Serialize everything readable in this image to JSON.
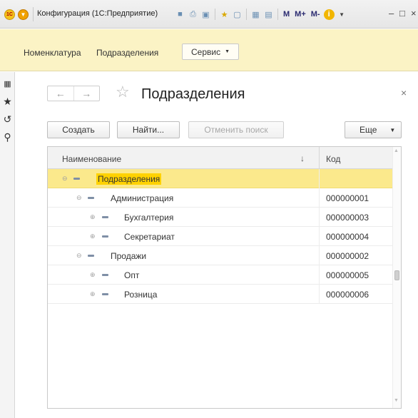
{
  "window": {
    "title": "Конфигурация (1С:Предприятие)",
    "logo_text": "1С",
    "toolbar_icons": [
      "save-icon",
      "print-icon",
      "preview-icon",
      "favorite-add-icon",
      "favorites-icon",
      "calculator-icon",
      "calendar-icon"
    ],
    "memory_buttons": [
      "M",
      "M+",
      "M-"
    ],
    "info_icon": "i",
    "minimize_label": "–",
    "close_label": "×"
  },
  "sections": {
    "items": [
      "Номенклатура",
      "Подразделения"
    ],
    "service_label": "Сервис"
  },
  "left_panel": {
    "icons": [
      "apps-grid-icon",
      "favorites-star-icon",
      "history-icon",
      "search-icon"
    ]
  },
  "form": {
    "title": "Подразделения",
    "buttons": {
      "create": "Создать",
      "find": "Найти...",
      "cancel_search": "Отменить поиск",
      "more": "Еще"
    },
    "close_label": "×"
  },
  "table": {
    "columns": {
      "name": "Наименование",
      "code": "Код"
    },
    "sort_indicator": "↓",
    "rows": [
      {
        "name": "Подразделения",
        "code": "",
        "level": 0,
        "state": "expanded",
        "selected": true
      },
      {
        "name": "Администрация",
        "code": "000000001",
        "level": 1,
        "state": "expanded",
        "selected": false
      },
      {
        "name": "Бухгалтерия",
        "code": "000000003",
        "level": 2,
        "state": "collapsed",
        "selected": false
      },
      {
        "name": "Секретариат",
        "code": "000000004",
        "level": 2,
        "state": "collapsed",
        "selected": false
      },
      {
        "name": "Продажи",
        "code": "000000002",
        "level": 1,
        "state": "expanded",
        "selected": false
      },
      {
        "name": "Опт",
        "code": "000000005",
        "level": 2,
        "state": "collapsed",
        "selected": false
      },
      {
        "name": "Розница",
        "code": "000000006",
        "level": 2,
        "state": "collapsed",
        "selected": false
      }
    ]
  },
  "colors": {
    "section_bar": "#fbf3c5",
    "selected_row": "#fbe98c",
    "highlight": "#ffd200"
  }
}
